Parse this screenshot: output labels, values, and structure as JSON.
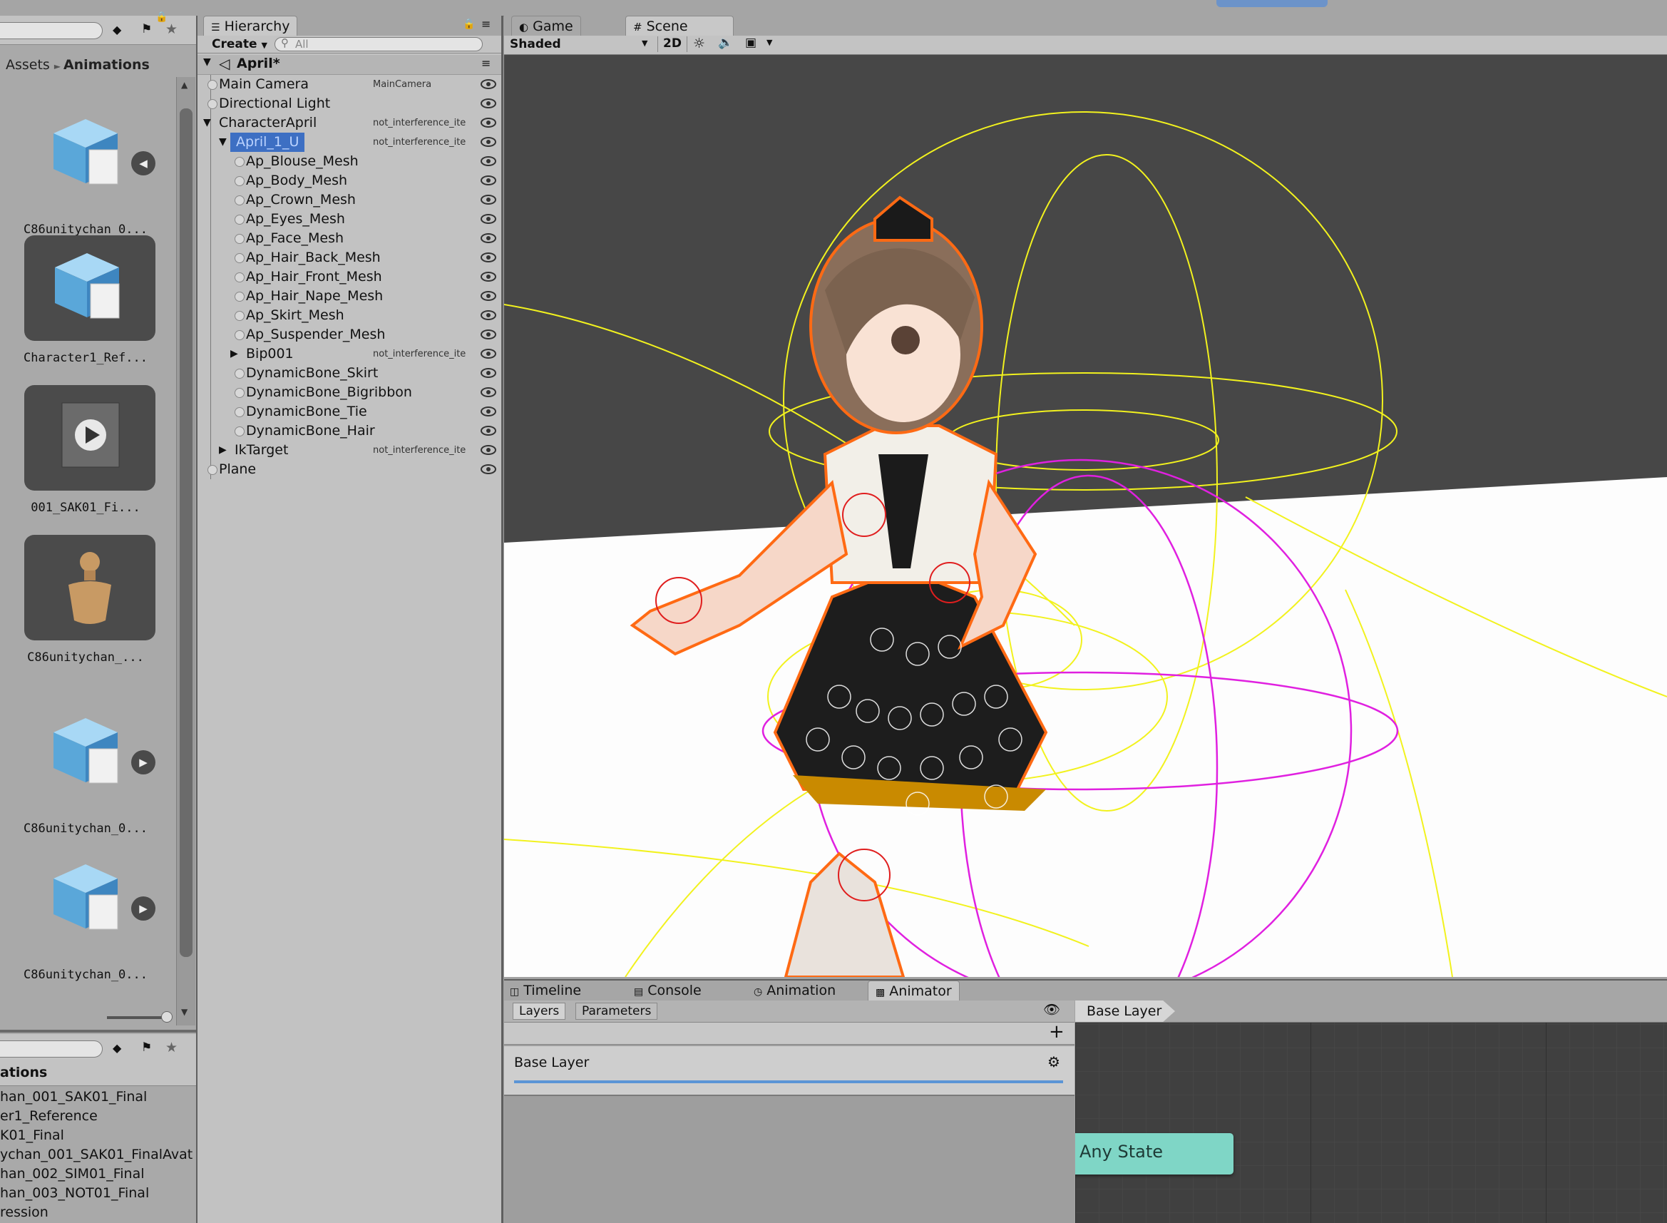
{
  "project": {
    "breadcrumb": [
      "Assets",
      "Animations"
    ],
    "assets": [
      {
        "label": "C86unitychan_0...",
        "icon": "prefab-cube-icon",
        "badge": "play-left"
      },
      {
        "label": "Character1_Ref...",
        "icon": "prefab-cube-icon",
        "badge": ""
      },
      {
        "label": "001_SAK01_Fi...",
        "icon": "animation-clip-icon",
        "badge": ""
      },
      {
        "label": "C86unitychan_...",
        "icon": "avatar-figure-icon",
        "badge": ""
      },
      {
        "label": "C86unitychan_0...",
        "icon": "prefab-cube-icon",
        "badge": "play"
      },
      {
        "label": "C86unitychan_0...",
        "icon": "prefab-cube-icon",
        "badge": "play"
      }
    ],
    "list_header": "ations",
    "list_items": [
      "han_001_SAK01_Final",
      "er1_Reference",
      "K01_Final",
      "ychan_001_SAK01_FinalAvat",
      "han_002_SIM01_Final",
      "han_003_NOT01_Final",
      "ression"
    ]
  },
  "hierarchy": {
    "tab": "Hierarchy",
    "create_label": "Create",
    "search_placeholder": "All",
    "scene_name": "April*",
    "rows": [
      {
        "name": "Main Camera",
        "tag": "MainCamera",
        "indent": 0
      },
      {
        "name": "Directional Light",
        "tag": "",
        "indent": 0
      },
      {
        "name": "CharacterApril",
        "tag": "not_interference_ite",
        "indent": 0
      },
      {
        "name": "April_1_U",
        "tag": "not_interference_ite",
        "indent": 1
      },
      {
        "name": "Ap_Blouse_Mesh",
        "tag": "",
        "indent": 2
      },
      {
        "name": "Ap_Body_Mesh",
        "tag": "",
        "indent": 2
      },
      {
        "name": "Ap_Crown_Mesh",
        "tag": "",
        "indent": 2
      },
      {
        "name": "Ap_Eyes_Mesh",
        "tag": "",
        "indent": 2
      },
      {
        "name": "Ap_Face_Mesh",
        "tag": "",
        "indent": 2
      },
      {
        "name": "Ap_Hair_Back_Mesh",
        "tag": "",
        "indent": 2
      },
      {
        "name": "Ap_Hair_Front_Mesh",
        "tag": "",
        "indent": 2
      },
      {
        "name": "Ap_Hair_Nape_Mesh",
        "tag": "",
        "indent": 2
      },
      {
        "name": "Ap_Skirt_Mesh",
        "tag": "",
        "indent": 2
      },
      {
        "name": "Ap_Suspender_Mesh",
        "tag": "",
        "indent": 2
      },
      {
        "name": "Bip001",
        "tag": "not_interference_ite",
        "indent": 2
      },
      {
        "name": "DynamicBone_Skirt",
        "tag": "",
        "indent": 2
      },
      {
        "name": "DynamicBone_Bigribbon",
        "tag": "",
        "indent": 2
      },
      {
        "name": "DynamicBone_Tie",
        "tag": "",
        "indent": 2
      },
      {
        "name": "DynamicBone_Hair",
        "tag": "",
        "indent": 2
      },
      {
        "name": "IkTarget",
        "tag": "not_interference_ite",
        "indent": 1
      },
      {
        "name": "Plane",
        "tag": "",
        "indent": 0
      }
    ]
  },
  "scene": {
    "tabs": [
      "Game",
      "Scene"
    ],
    "shading_mode": "Shaded",
    "mode_2d": "2D"
  },
  "bottom": {
    "tabs": [
      "Timeline",
      "Console",
      "Animation",
      "Animator"
    ],
    "sub_tabs": [
      "Layers",
      "Parameters"
    ],
    "layer_name": "Base Layer",
    "graph_breadcrumb": "Base Layer",
    "any_state_label": "Any State"
  },
  "colors": {
    "selection": "#3d6fc3",
    "any_state": "#7fd6c6",
    "gizmo_yellow": "#f2f21e",
    "gizmo_magenta": "#e020e0",
    "outline_orange": "#ff6a14"
  }
}
